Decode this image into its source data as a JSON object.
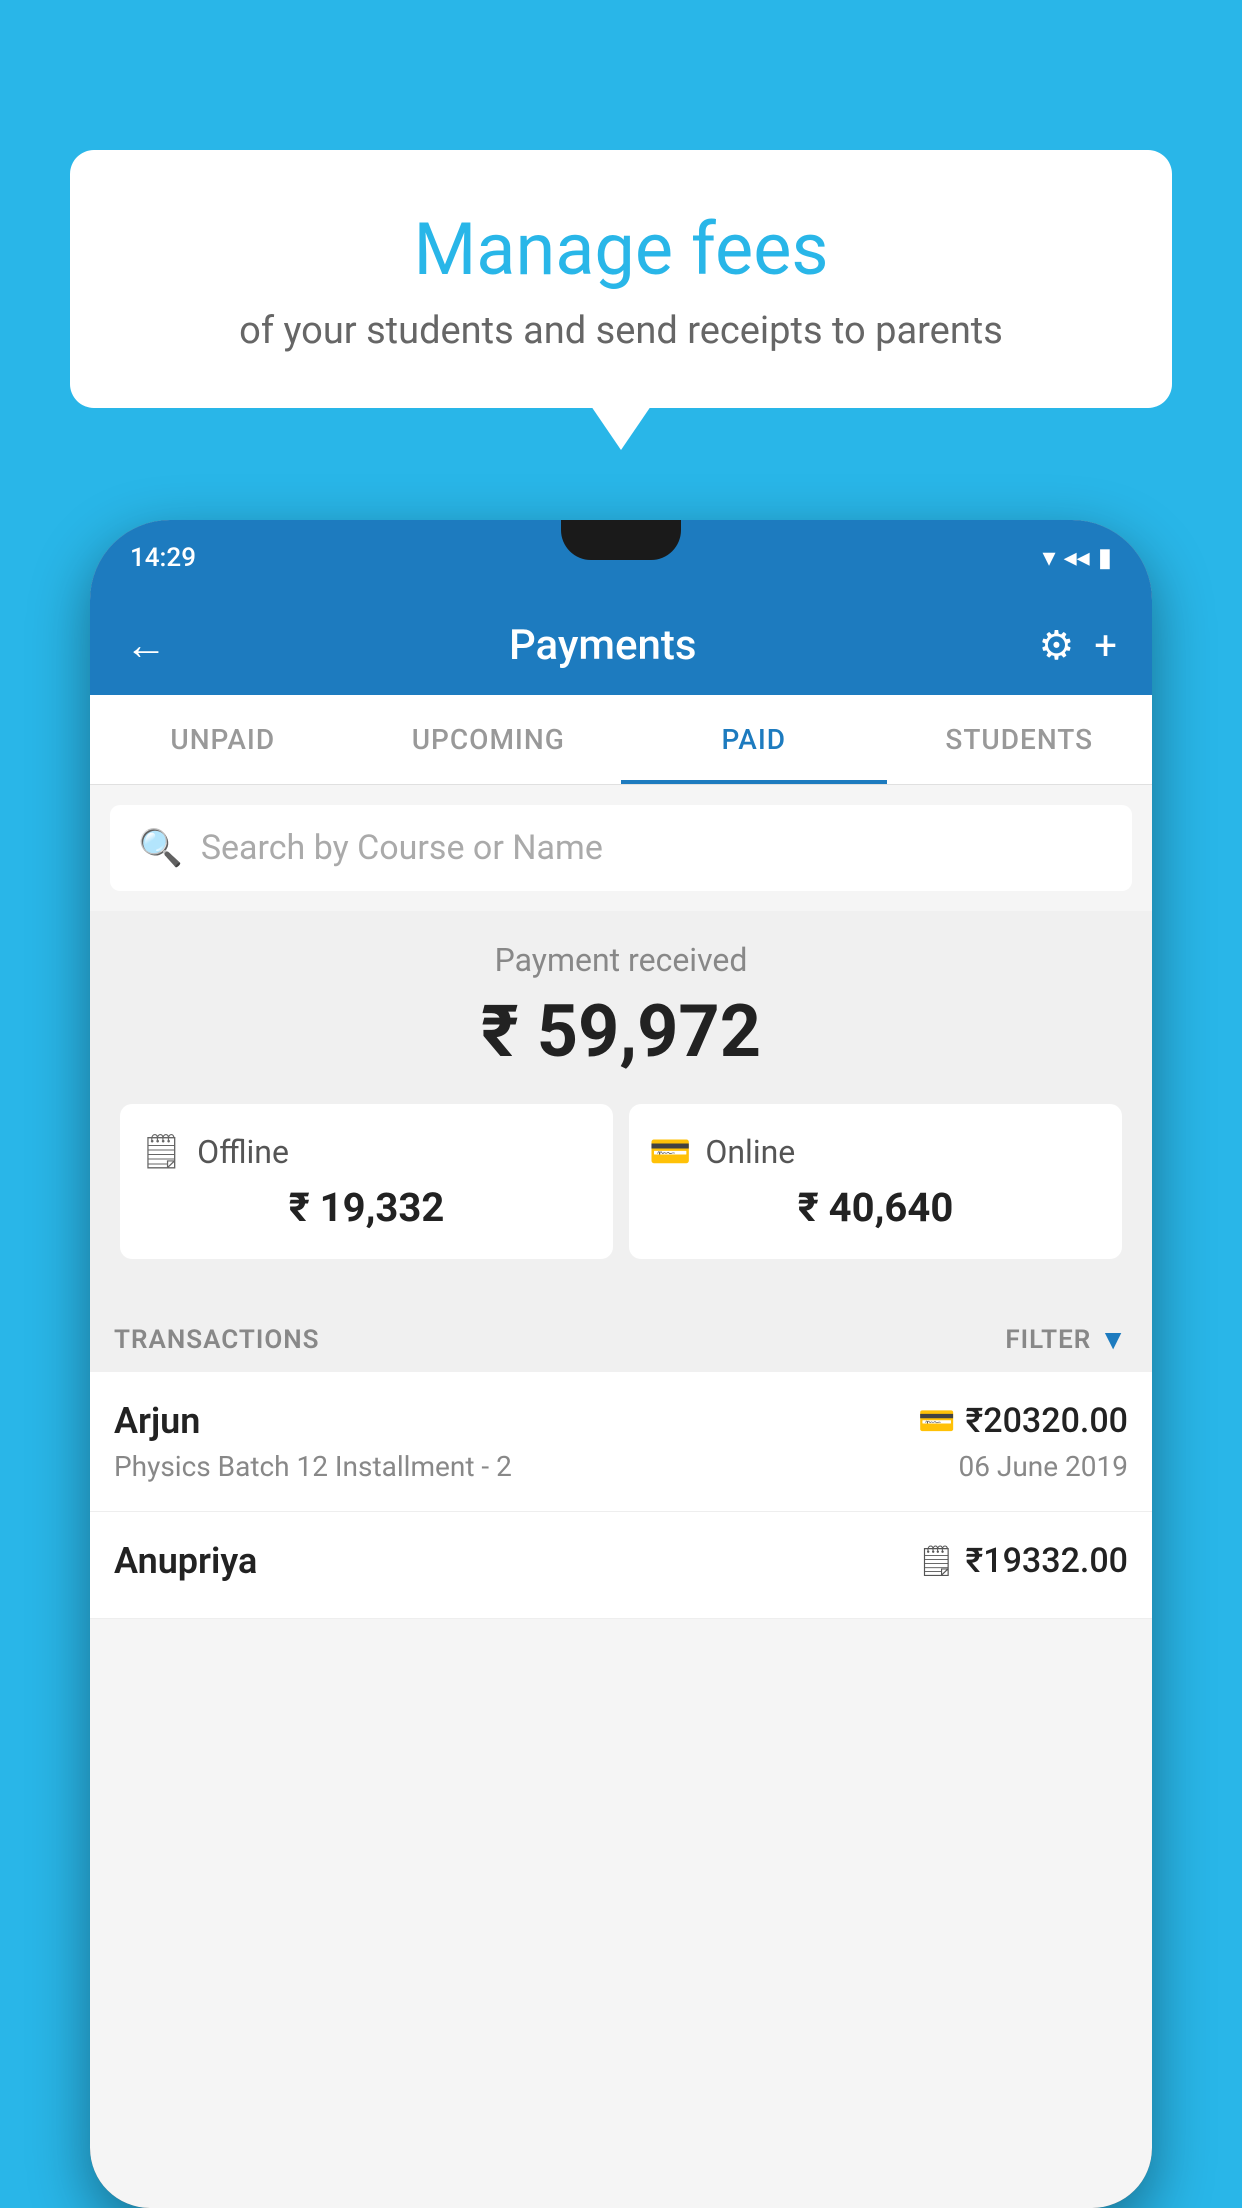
{
  "background_color": "#29B6E8",
  "speech_bubble": {
    "title": "Manage fees",
    "subtitle": "of your students and send receipts to parents"
  },
  "status_bar": {
    "time": "14:29",
    "icons": [
      "▾▾",
      "◂◂",
      "▮"
    ]
  },
  "header": {
    "title": "Payments",
    "back_label": "←",
    "settings_label": "⚙",
    "add_label": "+"
  },
  "tabs": [
    {
      "id": "unpaid",
      "label": "UNPAID",
      "active": false
    },
    {
      "id": "upcoming",
      "label": "UPCOMING",
      "active": false
    },
    {
      "id": "paid",
      "label": "PAID",
      "active": true
    },
    {
      "id": "students",
      "label": "STUDENTS",
      "active": false
    }
  ],
  "search": {
    "placeholder": "Search by Course or Name"
  },
  "payment_received": {
    "label": "Payment received",
    "amount": "₹ 59,972",
    "offline": {
      "type": "Offline",
      "amount": "₹ 19,332"
    },
    "online": {
      "type": "Online",
      "amount": "₹ 40,640"
    }
  },
  "transactions": {
    "section_label": "TRANSACTIONS",
    "filter_label": "FILTER",
    "items": [
      {
        "name": "Arjun",
        "course": "Physics Batch 12 Installment - 2",
        "amount": "₹20320.00",
        "date": "06 June 2019",
        "type": "online"
      },
      {
        "name": "Anupriya",
        "course": "",
        "amount": "₹19332.00",
        "date": "",
        "type": "offline"
      }
    ]
  }
}
